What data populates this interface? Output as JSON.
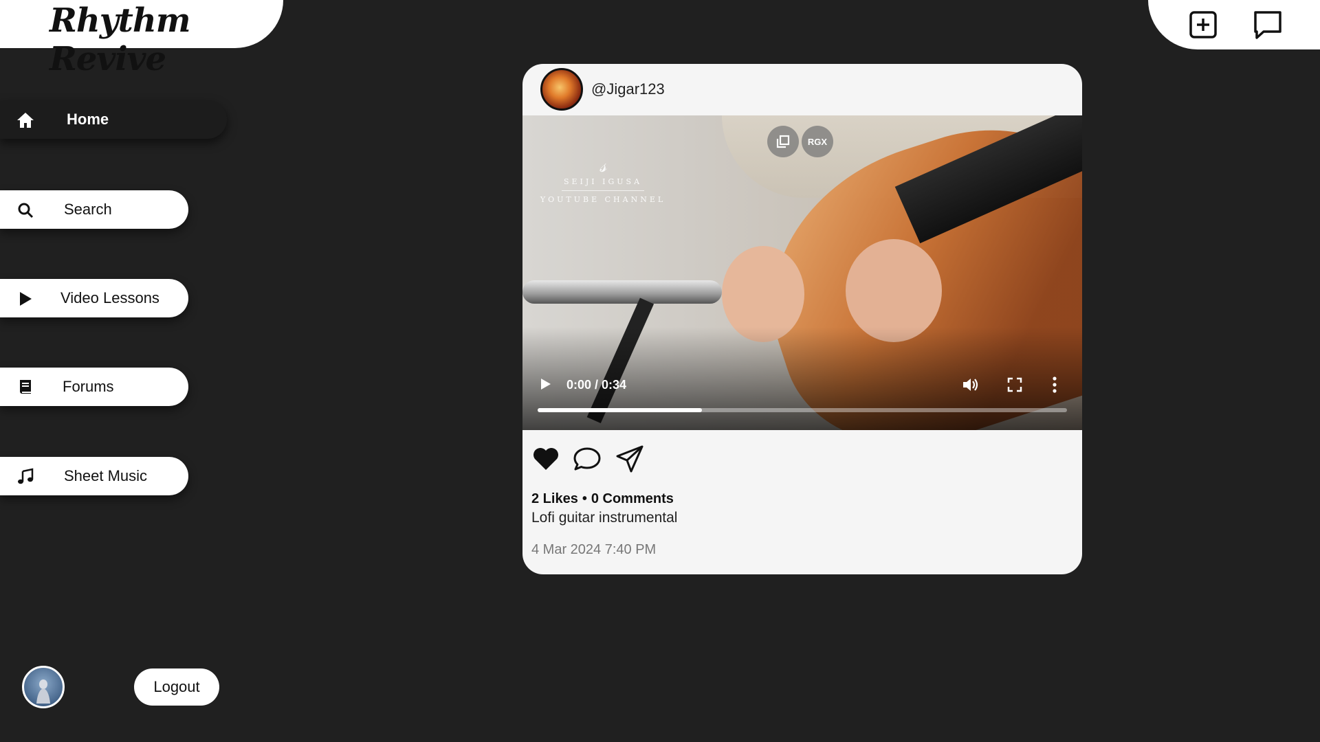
{
  "app": {
    "logo_text": "Rhythm Revive"
  },
  "top_actions": {
    "create_post": "plus-square-icon",
    "messages": "chat-bubble-icon"
  },
  "sidebar": {
    "items": [
      {
        "label": "Home",
        "icon": "home-icon",
        "active": true
      },
      {
        "label": "Search",
        "icon": "search-icon",
        "active": false
      },
      {
        "label": "Video Lessons",
        "icon": "play-icon",
        "active": false
      },
      {
        "label": "Forums",
        "icon": "book-icon",
        "active": false
      },
      {
        "label": "Sheet Music",
        "icon": "music-note-icon",
        "active": false
      }
    ],
    "logout_label": "Logout"
  },
  "post": {
    "username": "@Jigar123",
    "video": {
      "watermark_line1": "SEIJI IGUSA",
      "watermark_line2": "YOUTUBE CHANNEL",
      "overlay_badge": "RGX",
      "time_display": "0:00 / 0:34",
      "progress_fraction": 0.31
    },
    "likes": "2 Likes",
    "comments": "0 Comments",
    "caption": "Lofi guitar instrumental",
    "timestamp": "4 Mar 2024 7:40 PM"
  },
  "colors": {
    "background": "#202020",
    "card": "#f5f5f5",
    "surface": "#ffffff",
    "active_nav": "#1c1c1c"
  }
}
